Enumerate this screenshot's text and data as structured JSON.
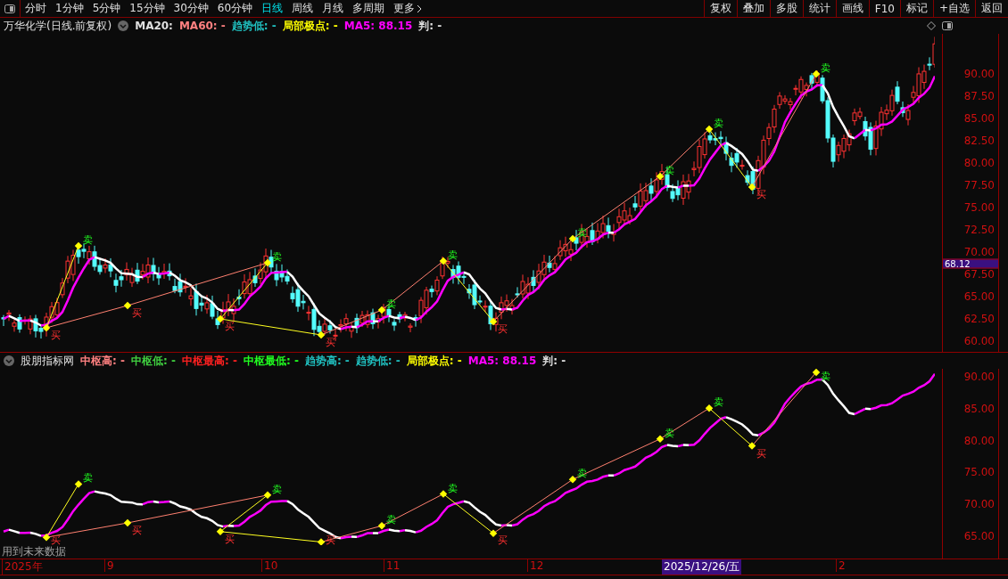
{
  "toolbar": {
    "periods": [
      {
        "label": "分时",
        "selected": false
      },
      {
        "label": "1分钟",
        "selected": false
      },
      {
        "label": "5分钟",
        "selected": false
      },
      {
        "label": "15分钟",
        "selected": false
      },
      {
        "label": "30分钟",
        "selected": false
      },
      {
        "label": "60分钟",
        "selected": false
      },
      {
        "label": "日线",
        "selected": true
      },
      {
        "label": "周线",
        "selected": false
      },
      {
        "label": "月线",
        "selected": false
      },
      {
        "label": "多周期",
        "selected": false
      },
      {
        "label": "更多",
        "selected": false
      }
    ],
    "actions": [
      "复权",
      "叠加",
      "多股",
      "统计",
      "画线",
      "F10",
      "标记",
      "+自选",
      "返回"
    ]
  },
  "main_legend": {
    "title": "万华化学(日线.前复权)",
    "items": [
      {
        "text": "MA20:",
        "color": "#e0e0e0"
      },
      {
        "text": "MA60: -",
        "color": "#ff8080"
      },
      {
        "text": "趋势低: -",
        "color": "#20c0c0"
      },
      {
        "text": "局部极点: -",
        "color": "#ffff00"
      },
      {
        "text": "MA5: 88.15",
        "color": "#ff00ff"
      },
      {
        "text": "判: -",
        "color": "#e0e0e0"
      }
    ]
  },
  "main_chart": {
    "price_axis": [
      "90.00",
      "87.50",
      "85.00",
      "82.50",
      "80.00",
      "77.50",
      "75.00",
      "72.50",
      "70.00",
      "67.50",
      "65.00",
      "62.50",
      "60.00"
    ],
    "current_price": "68.12",
    "signals": [
      {
        "label": "卖"
      },
      {
        "label": "卖"
      },
      {
        "label": "卖"
      },
      {
        "label": "卖"
      },
      {
        "label": "卖"
      },
      {
        "label": "卖"
      },
      {
        "label": "卖"
      },
      {
        "label": "卖"
      },
      {
        "label": "买"
      },
      {
        "label": "买"
      },
      {
        "label": "买"
      },
      {
        "label": "买"
      },
      {
        "label": "买"
      },
      {
        "label": "买"
      }
    ]
  },
  "indicator": {
    "title": "股朋指标网",
    "items": [
      {
        "text": "中枢高: -",
        "color": "#ff8080"
      },
      {
        "text": "中枢低: -",
        "color": "#40d040"
      },
      {
        "text": "中枢最高: -",
        "color": "#ff2020"
      },
      {
        "text": "中枢最低: -",
        "color": "#20ff20"
      },
      {
        "text": "趋势高: -",
        "color": "#20c0c0"
      },
      {
        "text": "趋势低: -",
        "color": "#20c0c0"
      },
      {
        "text": "局部极点: -",
        "color": "#ffff00"
      },
      {
        "text": "MA5: 88.15",
        "color": "#ff00ff"
      },
      {
        "text": "判: -",
        "color": "#e0e0e0"
      }
    ],
    "axis": [
      "90.00",
      "85.00",
      "80.00",
      "75.00",
      "70.00",
      "65.00"
    ],
    "signals": [
      {
        "label": "卖"
      },
      {
        "label": "卖"
      },
      {
        "label": "卖"
      },
      {
        "label": "卖"
      },
      {
        "label": "卖"
      },
      {
        "label": "卖"
      },
      {
        "label": "卖"
      },
      {
        "label": "卖"
      },
      {
        "label": "买"
      },
      {
        "label": "买"
      },
      {
        "label": "买"
      },
      {
        "label": "买"
      },
      {
        "label": "买"
      },
      {
        "label": "买"
      }
    ],
    "note": "用到未来数据"
  },
  "x_axis": {
    "labels": [
      "2025年",
      "9",
      "10",
      "11",
      "12",
      "2"
    ],
    "cursor_date": "2025/12/26/五"
  }
}
